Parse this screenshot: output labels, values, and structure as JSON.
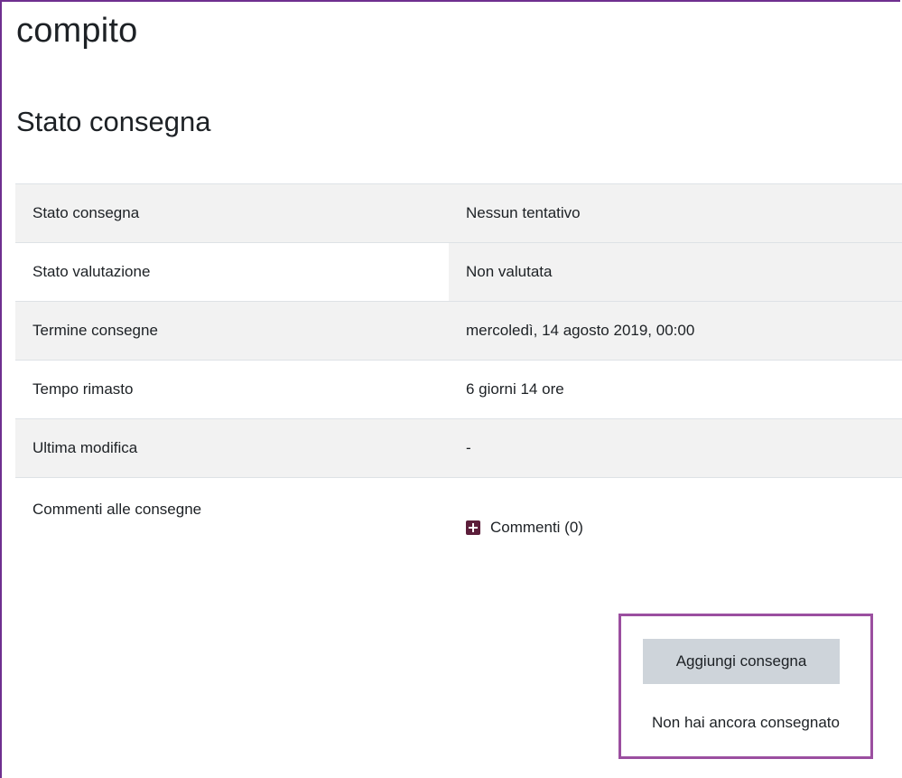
{
  "page": {
    "title": "compito",
    "section_title": "Stato consegna"
  },
  "status_table": {
    "rows": [
      {
        "label": "Stato consegna",
        "value": "Nessun tentativo"
      },
      {
        "label": "Stato valutazione",
        "value": "Non valutata"
      },
      {
        "label": "Termine consegne",
        "value": "mercoledì, 14 agosto 2019, 00:00"
      },
      {
        "label": "Tempo rimasto",
        "value": "6 giorni 14 ore"
      },
      {
        "label": "Ultima modifica",
        "value": "-"
      }
    ],
    "comments": {
      "label": "Commenti alle consegne",
      "link_label": "Commenti (0)",
      "icon": "plus-square-icon"
    }
  },
  "submission": {
    "add_button_label": "Aggiungi consegna",
    "note": "Non hai ancora consegnato"
  },
  "colors": {
    "accent_border": "#9b4fa0",
    "frame_border": "#6f2f8f",
    "button_bg": "#ced4da",
    "stripe_bg": "#f2f2f2",
    "icon_color": "#5c1e3a"
  }
}
